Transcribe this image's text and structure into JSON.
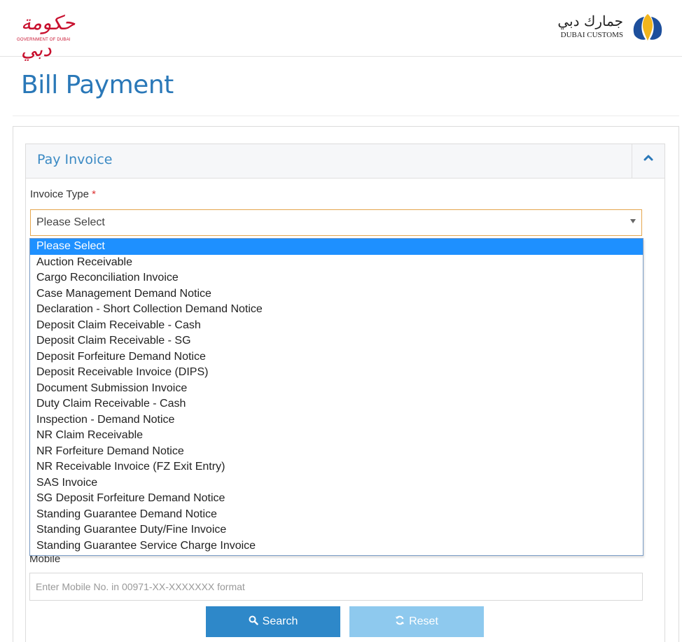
{
  "header": {
    "gov_logo_arabic": "حكومة دبي",
    "gov_logo_english": "GOVERNMENT OF DUBAI",
    "customs_arabic": "جمارك دبي",
    "customs_english": "DUBAI CUSTOMS"
  },
  "page": {
    "title": "Bill Payment"
  },
  "panel": {
    "title": "Pay Invoice",
    "collapse_icon": "chevron-up-icon"
  },
  "invoice_type": {
    "label": "Invoice Type",
    "required_mark": "*",
    "selected": "Please Select",
    "options": [
      "Please Select",
      "Auction Receivable",
      "Cargo Reconciliation Invoice",
      "Case Management Demand Notice",
      "Declaration - Short Collection Demand Notice",
      "Deposit Claim Receivable - Cash",
      "Deposit Claim Receivable - SG",
      "Deposit Forfeiture Demand Notice",
      "Deposit Receivable Invoice (DIPS)",
      "Document Submission Invoice",
      "Duty Claim Receivable - Cash",
      "Inspection - Demand Notice",
      "NR Claim Receivable",
      "NR Forfeiture Demand Notice",
      "NR Receivable Invoice (FZ Exit Entry)",
      "SAS Invoice",
      "SG Deposit Forfeiture Demand Notice",
      "Standing Guarantee Demand Notice",
      "Standing Guarantee Duty/Fine Invoice",
      "Standing Guarantee Service Charge Invoice"
    ],
    "highlighted_index": 0
  },
  "mobile": {
    "label": "Mobile",
    "placeholder": "Enter Mobile No. in 00971-XX-XXXXXXX format"
  },
  "buttons": {
    "search_label": "Search",
    "search_icon": "search-icon",
    "reset_label": "Reset",
    "reset_icon": "refresh-icon"
  },
  "colors": {
    "title_blue": "#2a78b8",
    "search_button": "#2e88c9",
    "reset_button": "#8ec9ee",
    "selected_option": "#1e90ff",
    "select_focus_border": "#e5a64d",
    "logo_red": "#c8102e"
  }
}
